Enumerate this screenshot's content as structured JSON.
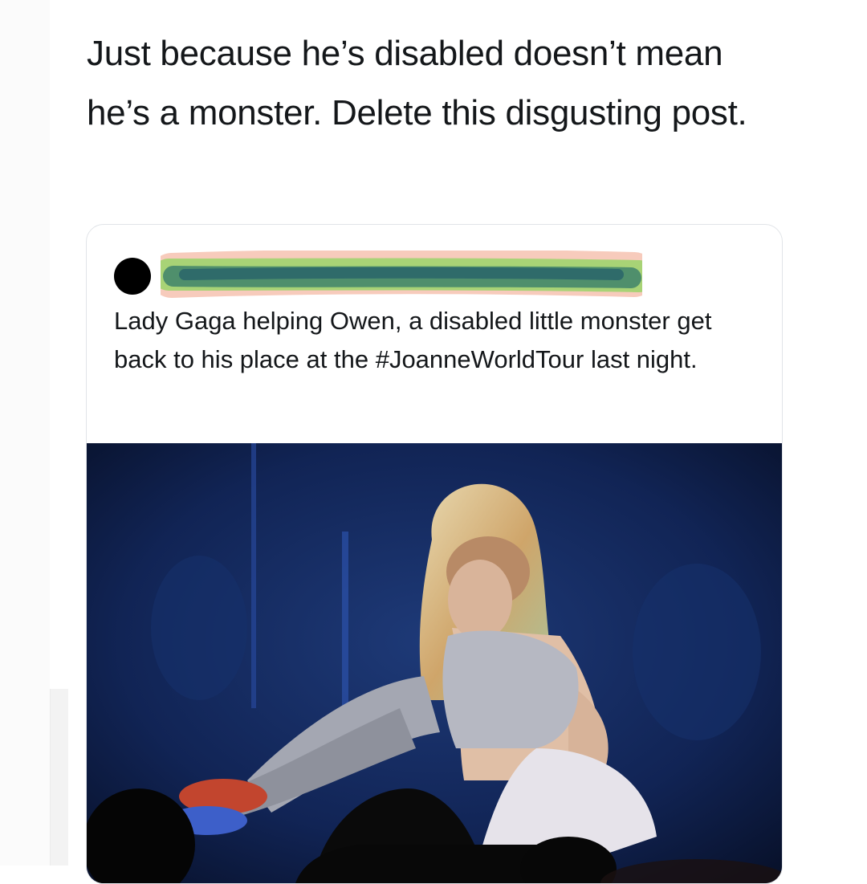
{
  "tweet": {
    "text": "Just because he’s disabled doesn’t mean he’s a monster. Delete this disgusting post."
  },
  "quoted_tweet": {
    "author_avatar_color": "#000000",
    "author_name_redacted": true,
    "text": "Lady Gaga helping Owen, a disabled little monster get back to his place at the #JoanneWorldTour last night.",
    "image_description_icon": "concert-photo"
  },
  "colors": {
    "text": "#14171a",
    "card_border": "#e1e4e8",
    "stage_blue": "#0c1a3a"
  }
}
